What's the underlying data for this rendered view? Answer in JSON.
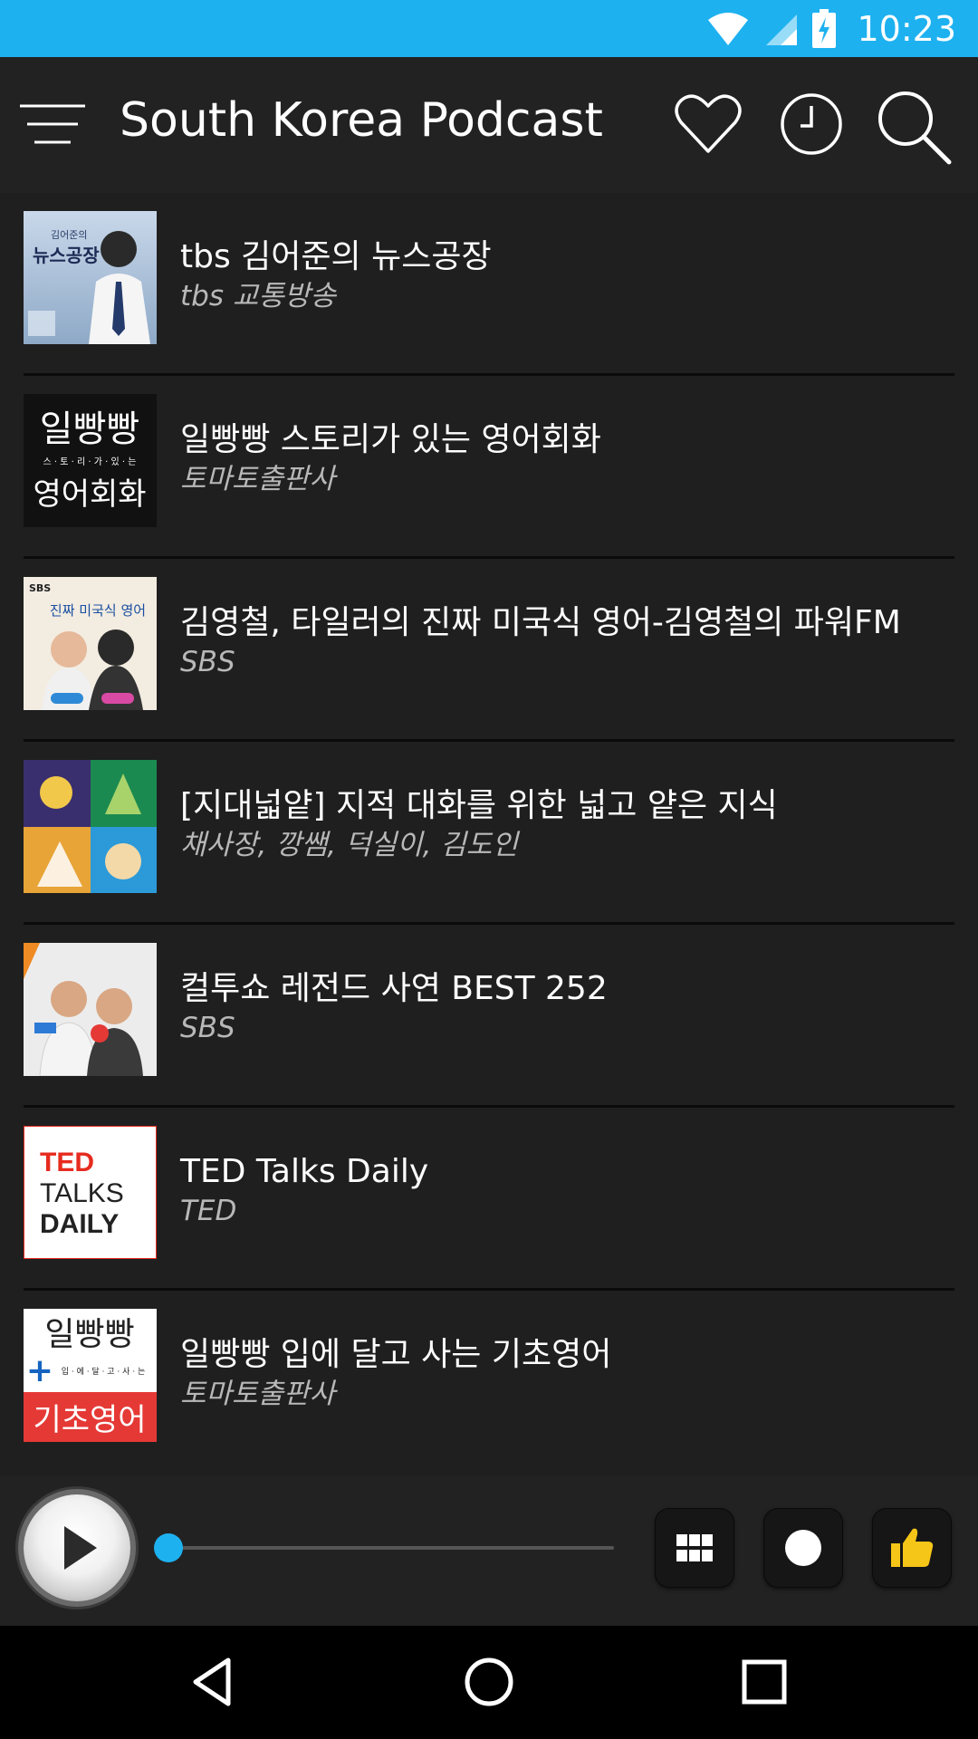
{
  "status_bar": {
    "time": "10:23",
    "icons": [
      "wifi-icon",
      "cell-signal-icon",
      "battery-charging-icon"
    ]
  },
  "app_bar": {
    "title": "South Korea Podcast",
    "icons": [
      "menu-icon",
      "heart-icon",
      "clock-icon",
      "search-icon"
    ]
  },
  "podcasts": [
    {
      "title": "tbs 김어준의 뉴스공장",
      "author": "tbs 교통방송",
      "art": {
        "main_text": "뉴스공장",
        "sub_text": "김어준의",
        "bg": "#a9bfd8"
      }
    },
    {
      "title": "일빵빵 스토리가 있는 영어회화",
      "author": "토마토출판사",
      "art": {
        "main_text": "일빵빵",
        "middle_text": "스 · 토 · 리 · 가 · 있 · 는",
        "bottom_text": "영어회화",
        "bg": "#111111"
      }
    },
    {
      "title": "김영철, 타일러의 진짜 미국식 영어-김영철의 파워FM",
      "author": "SBS",
      "art": {
        "main_text": "진짜 미국식 영어",
        "badge_text": "SBS",
        "bg": "#f3ece1"
      }
    },
    {
      "title": "[지대넓얕] 지적 대화를 위한 넓고 얕은 지식",
      "author": "채사장, 깡쌤, 덕실이, 김도인",
      "art": {
        "quadrant_colors": [
          "#3a2f6e",
          "#1b8a50",
          "#e8a437",
          "#2c9ad8"
        ]
      }
    },
    {
      "title": "컬투쇼 레전드 사연 BEST 252",
      "author": "SBS",
      "art": {
        "bg": "#ececec"
      }
    },
    {
      "title": "TED Talks Daily",
      "author": "TED",
      "art": {
        "line1": "TED",
        "line2": "TALKS",
        "line3": "DAILY",
        "accent": "#e62b1e"
      }
    },
    {
      "title": "일빵빵 입에 달고 사는 기초영어",
      "author": "토마토출판사",
      "art": {
        "main_text": "일빵빵",
        "middle_text": "입 · 에 · 달 · 고 · 사 · 는",
        "bottom_text": "기초영어",
        "plus": "+",
        "accent": "#e53935",
        "plus_color": "#1565c0"
      }
    }
  ],
  "player": {
    "progress": 0.0,
    "controls": [
      "play-icon",
      "grid-icon",
      "record-icon",
      "thumbs-up-icon"
    ],
    "accent": "#1eb1f0",
    "like_color": "#f5c518"
  },
  "nav_bar": {
    "icons": [
      "back-icon",
      "home-icon",
      "recents-icon"
    ]
  }
}
